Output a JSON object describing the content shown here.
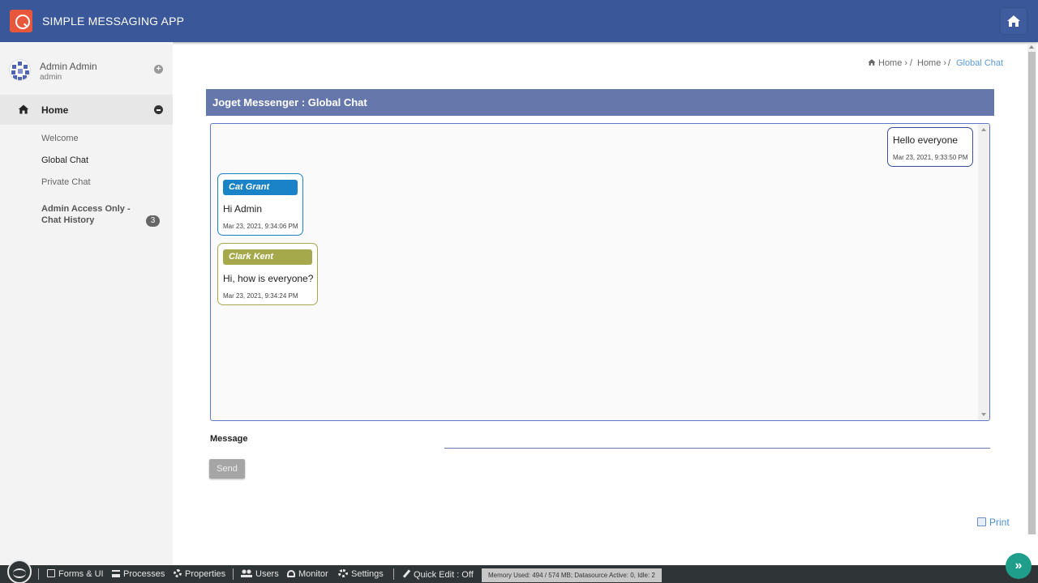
{
  "header": {
    "app_title": "SIMPLE MESSAGING APP",
    "colors": {
      "bar": "#3a5799",
      "logo": "#e8563b"
    }
  },
  "user": {
    "name": "Admin Admin",
    "id": "admin"
  },
  "sidebar": {
    "home_label": "Home",
    "items": [
      {
        "label": "Welcome"
      },
      {
        "label": "Global Chat"
      },
      {
        "label": "Private Chat"
      },
      {
        "label": "Admin Access Only - Chat History",
        "badge": "3"
      }
    ]
  },
  "breadcrumb": {
    "items": [
      {
        "label": "Home ›"
      },
      {
        "label": "/"
      },
      {
        "label": "Home ›"
      },
      {
        "label": "/"
      },
      {
        "label": "Global Chat"
      }
    ]
  },
  "panel": {
    "title": "Joget Messenger : Global Chat"
  },
  "messages": [
    {
      "text": "Hello everyone",
      "time": "Mar 23, 2021, 9:33:50 PM",
      "mine": true
    },
    {
      "sender": "Cat Grant",
      "text": "Hi Admin",
      "time": "Mar 23, 2021, 9:34:06 PM",
      "color": "#1a82c6"
    },
    {
      "sender": "Clark Kent",
      "text": "Hi, how is everyone?",
      "time": "Mar 23, 2021, 9:34:24 PM",
      "color": "#a5a94c"
    }
  ],
  "form": {
    "message_label": "Message",
    "message_value": "",
    "send_label": "Send"
  },
  "print_label": "Print",
  "toolbar": {
    "items": [
      {
        "label": "Forms & UI"
      },
      {
        "label": "Processes"
      },
      {
        "label": "Properties"
      },
      {
        "label": "Users"
      },
      {
        "label": "Monitor"
      },
      {
        "label": "Settings"
      },
      {
        "label": "Quick Edit : Off"
      }
    ],
    "memory": "Memory Used: 494 / 574 MB; Datasource Active: 0, Idle: 2",
    "go_symbol": "»"
  }
}
